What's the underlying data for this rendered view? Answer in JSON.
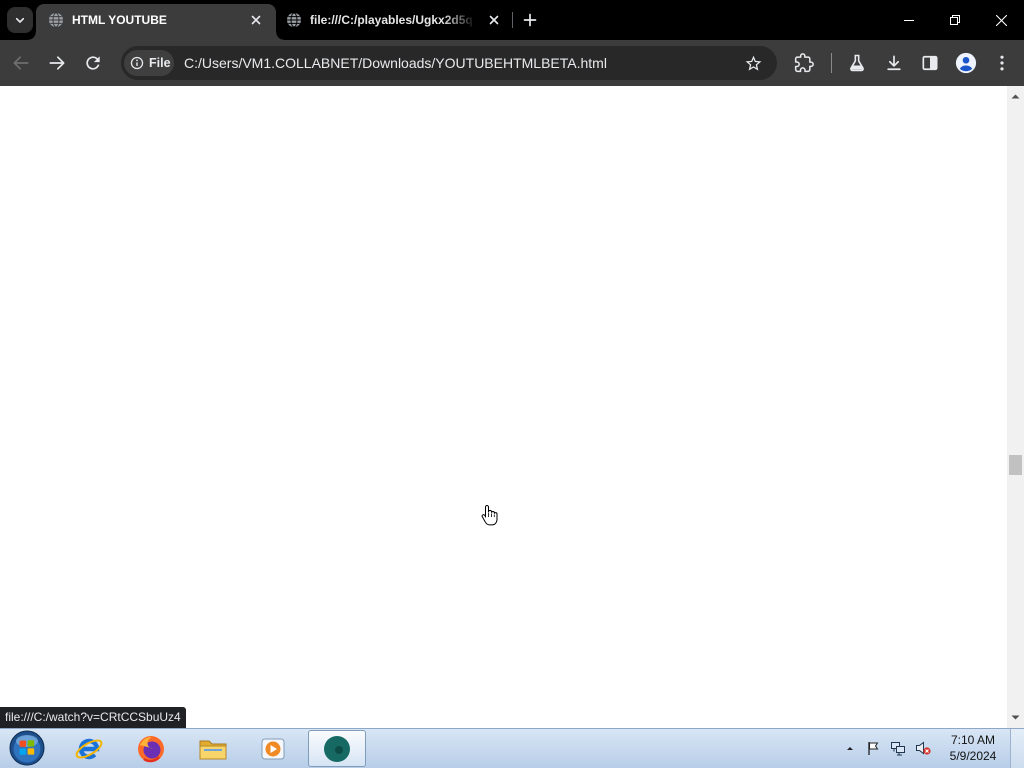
{
  "browser": {
    "tabs": [
      {
        "title": "HTML YOUTUBE",
        "favicon": "globe-icon",
        "active": true
      },
      {
        "title": "file:///C:/playables/Ugkx2d5q",
        "favicon": "globe-icon",
        "active": false
      }
    ],
    "tab_strip_icons": [
      "chevron-down-icon",
      "close-icon",
      "plus-icon"
    ],
    "window_controls": [
      "minimize-icon",
      "restore-icon",
      "close-icon"
    ],
    "navigation": {
      "back_enabled": false,
      "forward_enabled": true
    },
    "omnibox": {
      "chip_icon": "info-icon",
      "chip_label": "File",
      "url": "C:/Users/VM1.COLLABNET/Downloads/YOUTUBEHTMLBETA.html",
      "bookmark_icon": "star-outline-icon"
    },
    "toolbar_icons": [
      "back-arrow-icon",
      "forward-arrow-icon",
      "reload-icon",
      "extensions-puzzle-icon",
      "labs-flask-icon",
      "download-icon",
      "side-panel-icon",
      "profile-avatar-icon",
      "three-dot-menu-icon"
    ],
    "status_bubble": "file:///C:/watch?v=CRtCCSbuUz4"
  },
  "page": {
    "scroll_position": 0.6,
    "cursor": "hand-pointer-cursor"
  },
  "taskbar": {
    "start_button": "windows-start-orb-icon",
    "apps": [
      "internet-explorer-icon",
      "firefox-icon",
      "file-explorer-icon",
      "media-player-icon",
      "browser-app-icon"
    ],
    "active_app": "browser-app-icon",
    "tray_icons": [
      "show-hidden-icons-arrow",
      "action-center-flag-icon",
      "network-icon",
      "volume-muted-icon"
    ],
    "clock": {
      "time": "7:10 AM",
      "date": "5/9/2024"
    }
  },
  "colors": {
    "frame": "#000000",
    "toolbar": "#3c3c3c",
    "omnibox": "#282828",
    "page": "#ffffff",
    "taskbar": "#c6d8ee",
    "status_bubble": "#202124"
  }
}
